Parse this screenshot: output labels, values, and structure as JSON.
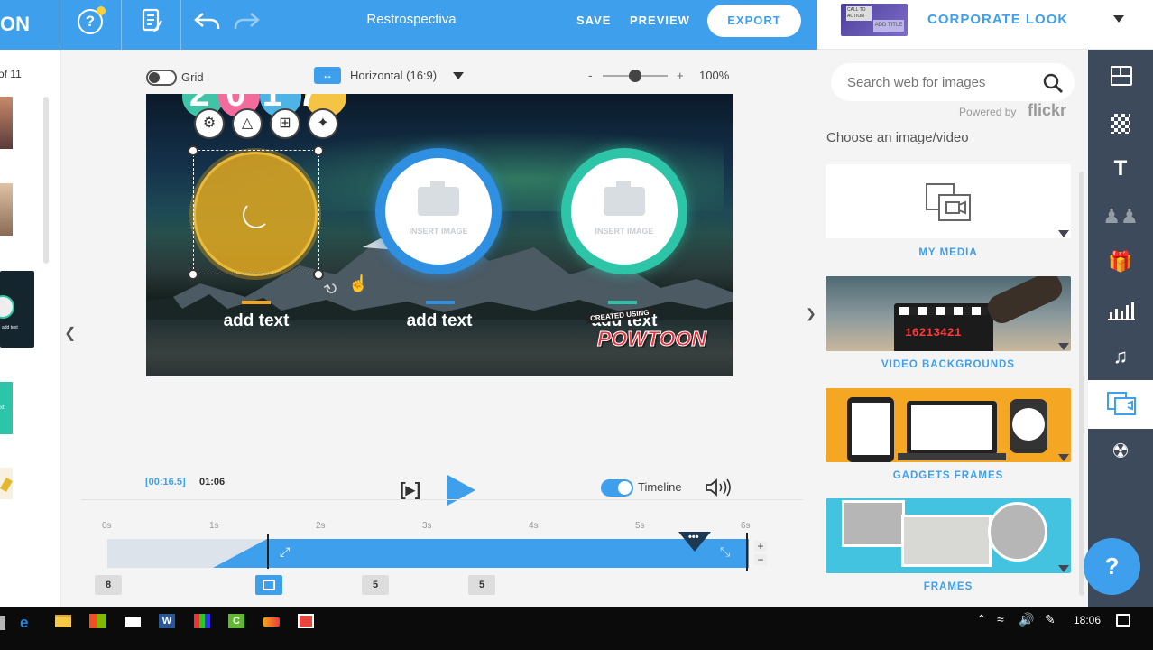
{
  "topbar": {
    "logo_fragment": "ON",
    "title": "Restrospectiva",
    "save_label": "SAVE",
    "preview_label": "PREVIEW",
    "export_label": "EXPORT"
  },
  "look": {
    "label": "CORPORATE LOOK",
    "thumb_text_1": "CALL TO ACTION",
    "thumb_text_2": "ADD TITLE"
  },
  "left_strip": {
    "slide_counter": "of 11",
    "slide_3_caption": "add text",
    "slide_4_caption": "xt"
  },
  "stage": {
    "grid_label": "Grid",
    "aspect_label": "Horizontal (16:9)",
    "zoom_minus": "-",
    "zoom_plus": "+",
    "zoom_value": "100%",
    "zoom_fraction": 0.5
  },
  "canvas": {
    "year_text": "2017",
    "insert_image_label": "INSERT IMAGE",
    "add_text_1": "add text",
    "add_text_2": "add text",
    "add_text_3": "add text",
    "watermark_created": "CREATED USING",
    "watermark_brand": "POWTOON",
    "accent_colors": [
      "#f2a31a",
      "#2f8fe0",
      "#2ec4a7"
    ]
  },
  "timeline": {
    "current_time": "[00:16.5]",
    "total_time": "01:06",
    "timeline_toggle_label": "Timeline",
    "ticks": [
      "0s",
      "1s",
      "2s",
      "3s",
      "4s",
      "5s",
      "6s"
    ],
    "markers": [
      "8",
      "",
      "5",
      "5"
    ]
  },
  "right_panel": {
    "search_placeholder": "Search web for images",
    "powered_by": "Powered by",
    "flickr": "flickr",
    "heading": "Choose an image/video",
    "cards": [
      {
        "label": "MY MEDIA"
      },
      {
        "label": "VIDEO BACKGROUNDS",
        "clapper_text": "16213421"
      },
      {
        "label": "GADGETS FRAMES"
      },
      {
        "label": "FRAMES"
      }
    ]
  },
  "help": {
    "label": "?"
  },
  "taskbar": {
    "clock": "18:06"
  },
  "colors": {
    "brand_blue": "#3ea0ec",
    "toolbar_dark": "#3d4a5c"
  }
}
